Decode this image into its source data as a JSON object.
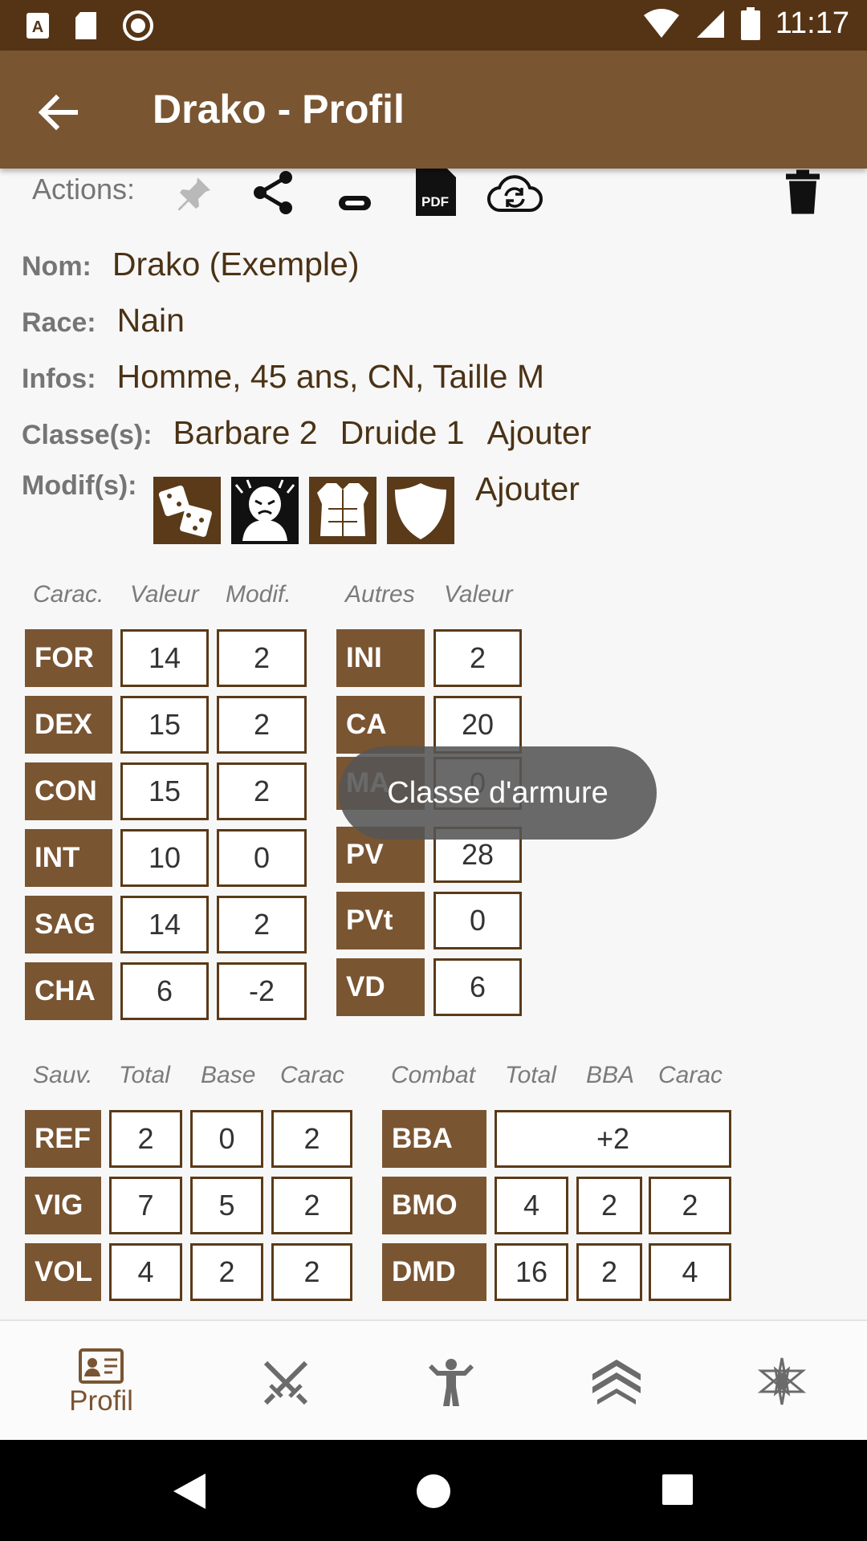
{
  "status_bar": {
    "time": "11:17"
  },
  "app_bar": {
    "title": "Drako - Profil"
  },
  "actions": {
    "label": "Actions:",
    "pdf_label": "PDF"
  },
  "profile": {
    "name_label": "Nom:",
    "name": "Drako (Exemple)",
    "race_label": "Race:",
    "race": "Nain",
    "info_label": "Infos:",
    "info": "Homme, 45 ans, CN, Taille M",
    "classes_label": "Classe(s):",
    "classes": [
      "Barbare 2",
      "Druide 1"
    ],
    "classes_add": "Ajouter",
    "modifs_label": "Modif(s):",
    "modifs_add": "Ajouter",
    "modif_icons": [
      "dice-icon",
      "rage-face-icon",
      "armor-icon",
      "shield-icon"
    ]
  },
  "abilities": {
    "headers": [
      "Carac.",
      "Valeur",
      "Modif."
    ],
    "rows": [
      {
        "name": "FOR",
        "value": "14",
        "mod": "2"
      },
      {
        "name": "DEX",
        "value": "15",
        "mod": "2"
      },
      {
        "name": "CON",
        "value": "15",
        "mod": "2"
      },
      {
        "name": "INT",
        "value": "10",
        "mod": "0"
      },
      {
        "name": "SAG",
        "value": "14",
        "mod": "2"
      },
      {
        "name": "CHA",
        "value": "6",
        "mod": "-2"
      }
    ]
  },
  "others": {
    "headers": [
      "Autres",
      "Valeur"
    ],
    "rows": [
      {
        "name": "INI",
        "value": "2"
      },
      {
        "name": "CA",
        "value": "20"
      },
      {
        "name": "MA",
        "value": "0"
      },
      {
        "name": "PV",
        "value": "28"
      },
      {
        "name": "PVt",
        "value": "0"
      },
      {
        "name": "VD",
        "value": "6"
      }
    ]
  },
  "saves": {
    "headers": [
      "Sauv.",
      "Total",
      "Base",
      "Carac"
    ],
    "rows": [
      {
        "name": "REF",
        "total": "2",
        "base": "0",
        "carac": "2"
      },
      {
        "name": "VIG",
        "total": "7",
        "base": "5",
        "carac": "2"
      },
      {
        "name": "VOL",
        "total": "4",
        "base": "2",
        "carac": "2"
      }
    ]
  },
  "combat": {
    "headers": [
      "Combat",
      "Total",
      "BBA",
      "Carac"
    ],
    "bba": {
      "name": "BBA",
      "value": "+2"
    },
    "rows": [
      {
        "name": "BMO",
        "total": "4",
        "bba": "2",
        "carac": "2"
      },
      {
        "name": "DMD",
        "total": "16",
        "bba": "2",
        "carac": "4"
      }
    ]
  },
  "toast": "Classe d'armure",
  "bottom_nav": {
    "active_label": "Profil"
  },
  "colors": {
    "primary": "#7a5532",
    "status": "#553416",
    "text_brown": "#4b3215"
  }
}
